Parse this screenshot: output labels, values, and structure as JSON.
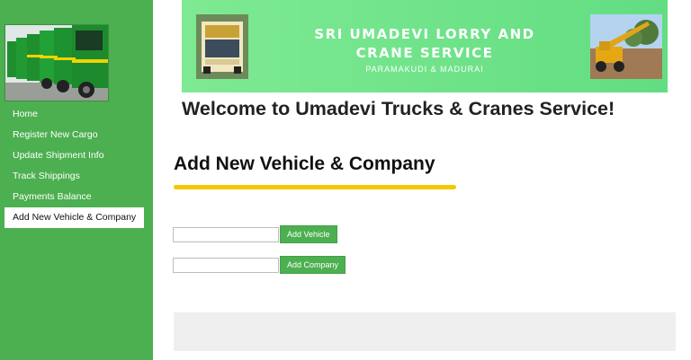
{
  "sidebar": {
    "image": "fleet-of-green-trucks",
    "nav_items": [
      {
        "label": "Home"
      },
      {
        "label": "Register New Cargo"
      },
      {
        "label": "Update Shipment Info"
      },
      {
        "label": "Track Shippings"
      },
      {
        "label": "Payments Balance"
      },
      {
        "label": "Add New Vehicle & Company",
        "active": true
      }
    ]
  },
  "banner": {
    "title_line1": "SRI UMADEVI LORRY AND",
    "title_line2": "CRANE SERVICE",
    "subtitle": "PARAMAKUDI & MADURAI",
    "left_image": "lorry-photo",
    "right_image": "crane-photo"
  },
  "main": {
    "welcome": "Welcome to Umadevi Trucks & Cranes Service!",
    "section_title": "Add New Vehicle & Company",
    "vehicle_input_value": "",
    "add_vehicle_label": "Add Vehicle",
    "company_input_value": "",
    "add_company_label": "Add Company"
  },
  "colors": {
    "sidebar": "#4caf50",
    "banner": "#6ee28a",
    "accent_underline": "#f6c800",
    "button": "#4caf50"
  }
}
